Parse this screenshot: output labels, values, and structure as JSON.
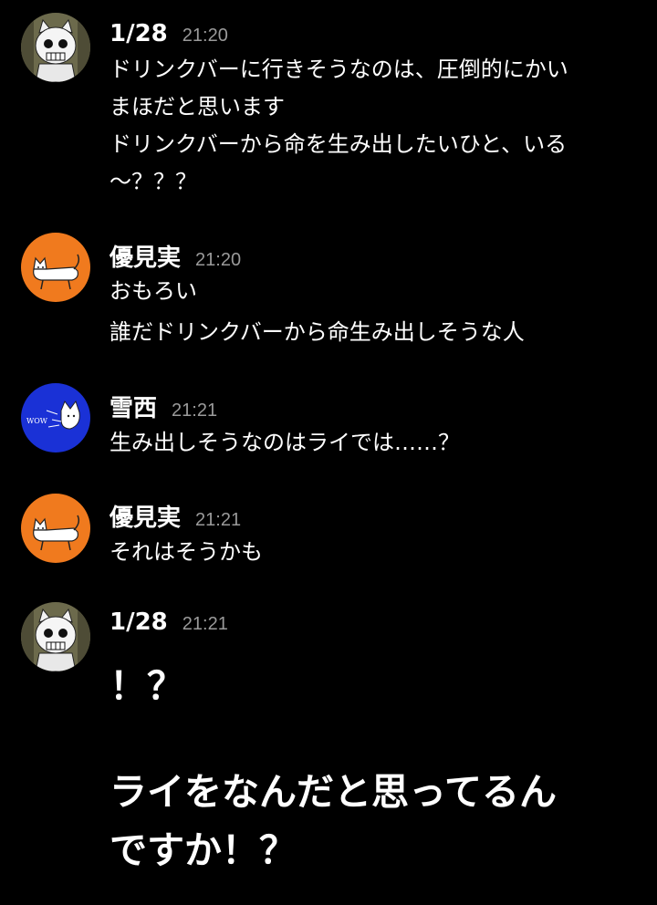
{
  "messages": [
    {
      "sender": "1/28",
      "time": "21:20",
      "avatar": "cat-skull-icon",
      "lines": [
        "ドリンクバーに行きそうなのは、圧倒的にかい",
        "まほだと思います",
        "ドリンクバーから命を生み出したいひと、いる",
        "～？？？"
      ]
    },
    {
      "sender": "優見実",
      "time": "21:20",
      "avatar": "orange-cat-icon",
      "lines": [
        "おもろい",
        "誰だドリンクバーから命生み出しそうな人"
      ]
    },
    {
      "sender": "雪西",
      "time": "21:21",
      "avatar": "blue-cat-wow-icon",
      "avatar_text": "WOW",
      "lines": [
        "生み出しそうなのはライでは……？"
      ]
    },
    {
      "sender": "優見実",
      "time": "21:21",
      "avatar": "orange-cat-icon",
      "lines": [
        "それはそうかも"
      ]
    },
    {
      "sender": "1/28",
      "time": "21:21",
      "avatar": "cat-skull-icon",
      "big_lines": [
        "！？",
        "",
        "ライをなんだと思ってるん",
        "ですか！？"
      ]
    }
  ],
  "colors": {
    "background": "#000000",
    "text": "#ffffff",
    "timestamp": "#9a9a9a",
    "orange_avatar": "#f07a1e",
    "blue_avatar": "#1a31d6"
  }
}
